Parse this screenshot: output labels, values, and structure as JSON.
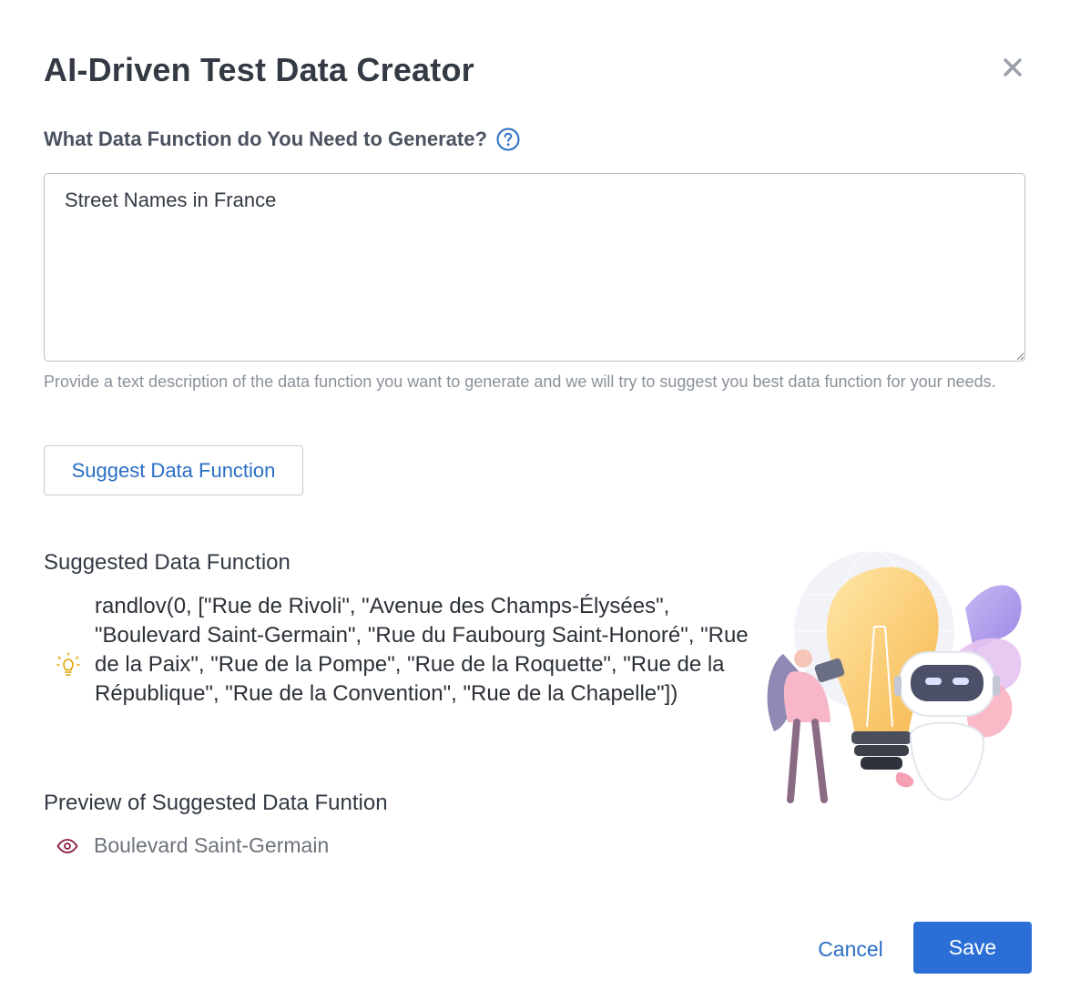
{
  "dialog": {
    "title": "AI-Driven Test Data Creator",
    "close_icon": "close-icon"
  },
  "form": {
    "question_label": "What Data Function do You Need to Generate?",
    "help_icon": "question-circle-icon",
    "description_value": "Street Names in France",
    "helper_text": "Provide a text description of the data function you want to generate and we will try to suggest you best data function for your needs.",
    "suggest_button_label": "Suggest Data Function"
  },
  "suggestion": {
    "title": "Suggested Data Function",
    "icon": "lightbulb-icon",
    "function_text": "randlov(0, [\"Rue de Rivoli\", \"Avenue des Champs-Élysées\", \"Boulevard Saint-Germain\", \"Rue du Faubourg Saint-Honoré\", \"Rue de la Paix\", \"Rue de la Pompe\", \"Rue de la Roquette\", \"Rue de la République\", \"Rue de la Convention\", \"Rue de la Chapelle\"])"
  },
  "preview": {
    "title": "Preview of Suggested Data Funtion",
    "icon": "eye-icon",
    "value": "Boulevard Saint-Germain"
  },
  "footer": {
    "cancel_label": "Cancel",
    "save_label": "Save"
  },
  "colors": {
    "accent": "#2b6fd6",
    "link": "#2a6fc4",
    "bulb": "#e0a200",
    "eye": "#8b1e3f"
  }
}
